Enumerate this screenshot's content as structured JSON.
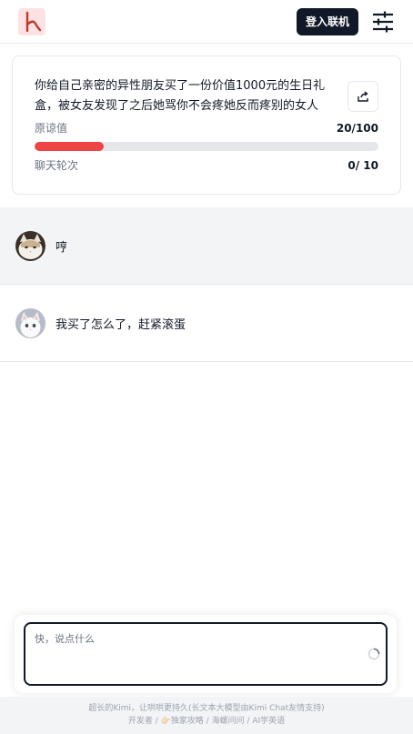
{
  "header": {
    "login_label": "登入联机",
    "logo_icon": "k-logo-icon",
    "settings_icon": "sliders-icon"
  },
  "scenario": {
    "text": "你给自己亲密的异性朋友买了一份价值1000元的生日礼盒，被女友发现了之后她骂你不会疼她反而疼别的女人",
    "share_icon": "share-icon",
    "forgiveness_label": "原谅值",
    "forgiveness_value": "20/100",
    "forgiveness_fraction": 0.2,
    "rounds_label": "聊天轮次",
    "rounds_value": "0/ 10"
  },
  "messages": [
    {
      "role": "girlfriend",
      "text": "哼"
    },
    {
      "role": "user",
      "text": "我买了怎么了，赶紧滚蛋"
    }
  ],
  "composer": {
    "placeholder": "快，说点什么"
  },
  "footer": {
    "line1": "超长的Kimi，让哄哄更持久(长文本大模型由Kimi Chat友情支持)",
    "links": [
      "开发者",
      "👉🏻独家攻略",
      "海螺问问",
      "AI学英语"
    ]
  },
  "colors": {
    "progress": "#ef4444",
    "primary": "#111827"
  }
}
